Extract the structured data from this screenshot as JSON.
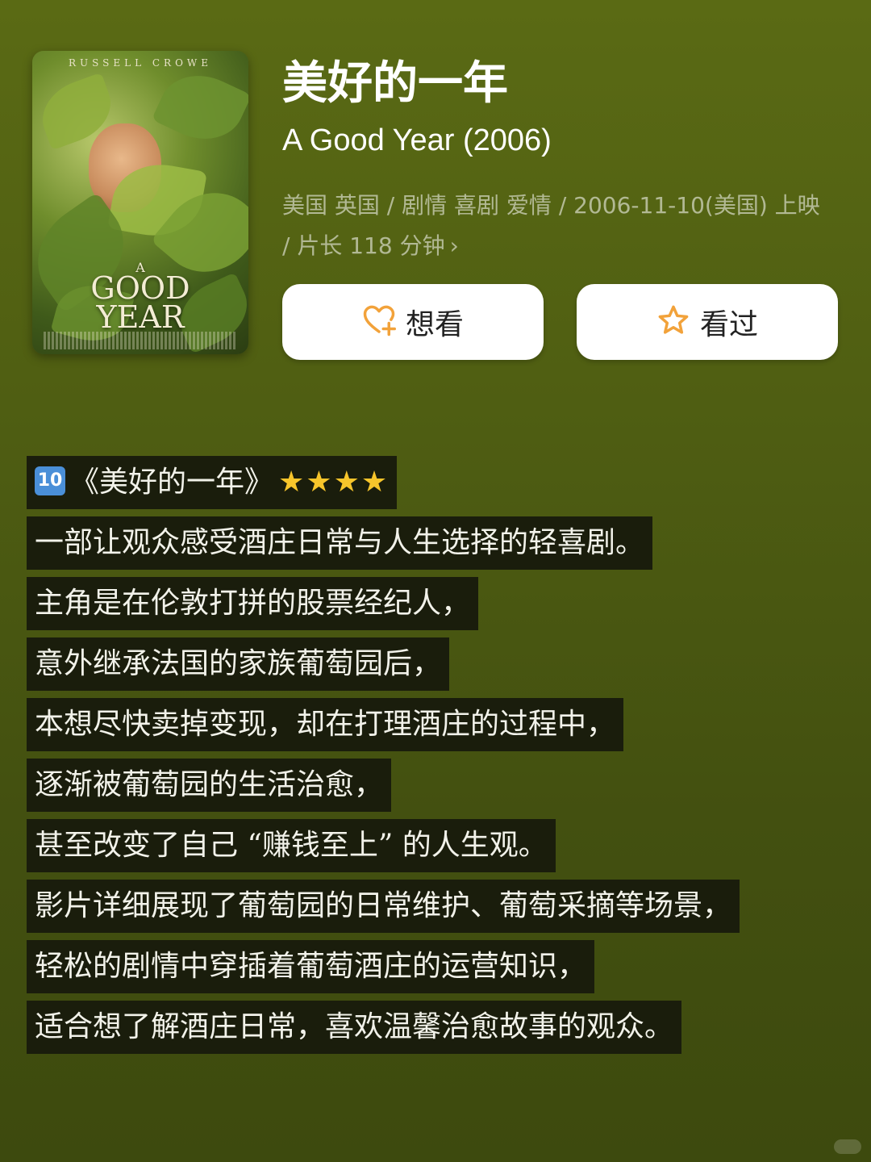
{
  "movie": {
    "title_cn": "美好的一年",
    "title_en": "A Good Year (2006)",
    "meta": "美国 英国 / 剧情 喜剧 爱情 / 2006-11-10(美国) 上映 / 片长 118 分钟",
    "meta_chevron": "›"
  },
  "poster": {
    "actor": "RUSSELL CROWE",
    "title_top": "A",
    "title_mid": "GOOD",
    "title_bottom": "YEAR"
  },
  "buttons": {
    "want": {
      "label": "想看",
      "icon": "heart-plus-icon",
      "color": "#f2a23a"
    },
    "seen": {
      "label": "看过",
      "icon": "star-outline-icon",
      "color": "#f2a23a"
    }
  },
  "review": {
    "rank": "10",
    "title": "《美好的一年》",
    "stars": "★★★★",
    "lines": [
      "一部让观众感受酒庄日常与人生选择的轻喜剧。",
      "主角是在伦敦打拼的股票经纪人，",
      "意外继承法国的家族葡萄园后，",
      "本想尽快卖掉变现，却在打理酒庄的过程中，",
      "逐渐被葡萄园的生活治愈，",
      "甚至改变了自己 “赚钱至上” 的人生观。",
      "影片详细展现了葡萄园的日常维护、葡萄采摘等场景，",
      "轻松的剧情中穿插着葡萄酒庄的运营知识，",
      "适合想了解酒庄日常，喜欢温馨治愈故事的观众。"
    ]
  }
}
